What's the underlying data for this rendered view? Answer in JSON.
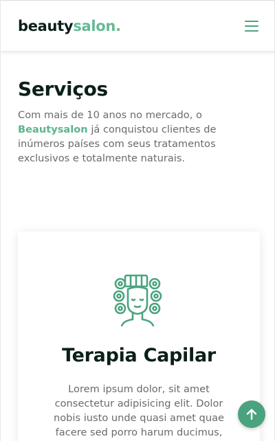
{
  "header": {
    "logo_dark": "beauty",
    "logo_accent": "salon."
  },
  "services": {
    "title": "Serviços",
    "intro_before": "Com mais de 10 anos no mercado, o ",
    "intro_brand": "Beautysalon",
    "intro_after": " já conquistou clientes de inúmeros países com seus tratamentos exclusivos e totalmente naturais."
  },
  "card": {
    "icon": "hair-rollers-icon",
    "title": "Terapia Capilar",
    "text": "Lorem ipsum dolor, sit amet consectetur adipisicing elit. Dolor nobis iusto unde quasi amet quae facere sed porro harum ducimus,"
  },
  "colors": {
    "accent": "#4aa37e",
    "accent_light": "#66bb95",
    "dark": "#0c1f1a",
    "text": "#6a6a6a"
  }
}
